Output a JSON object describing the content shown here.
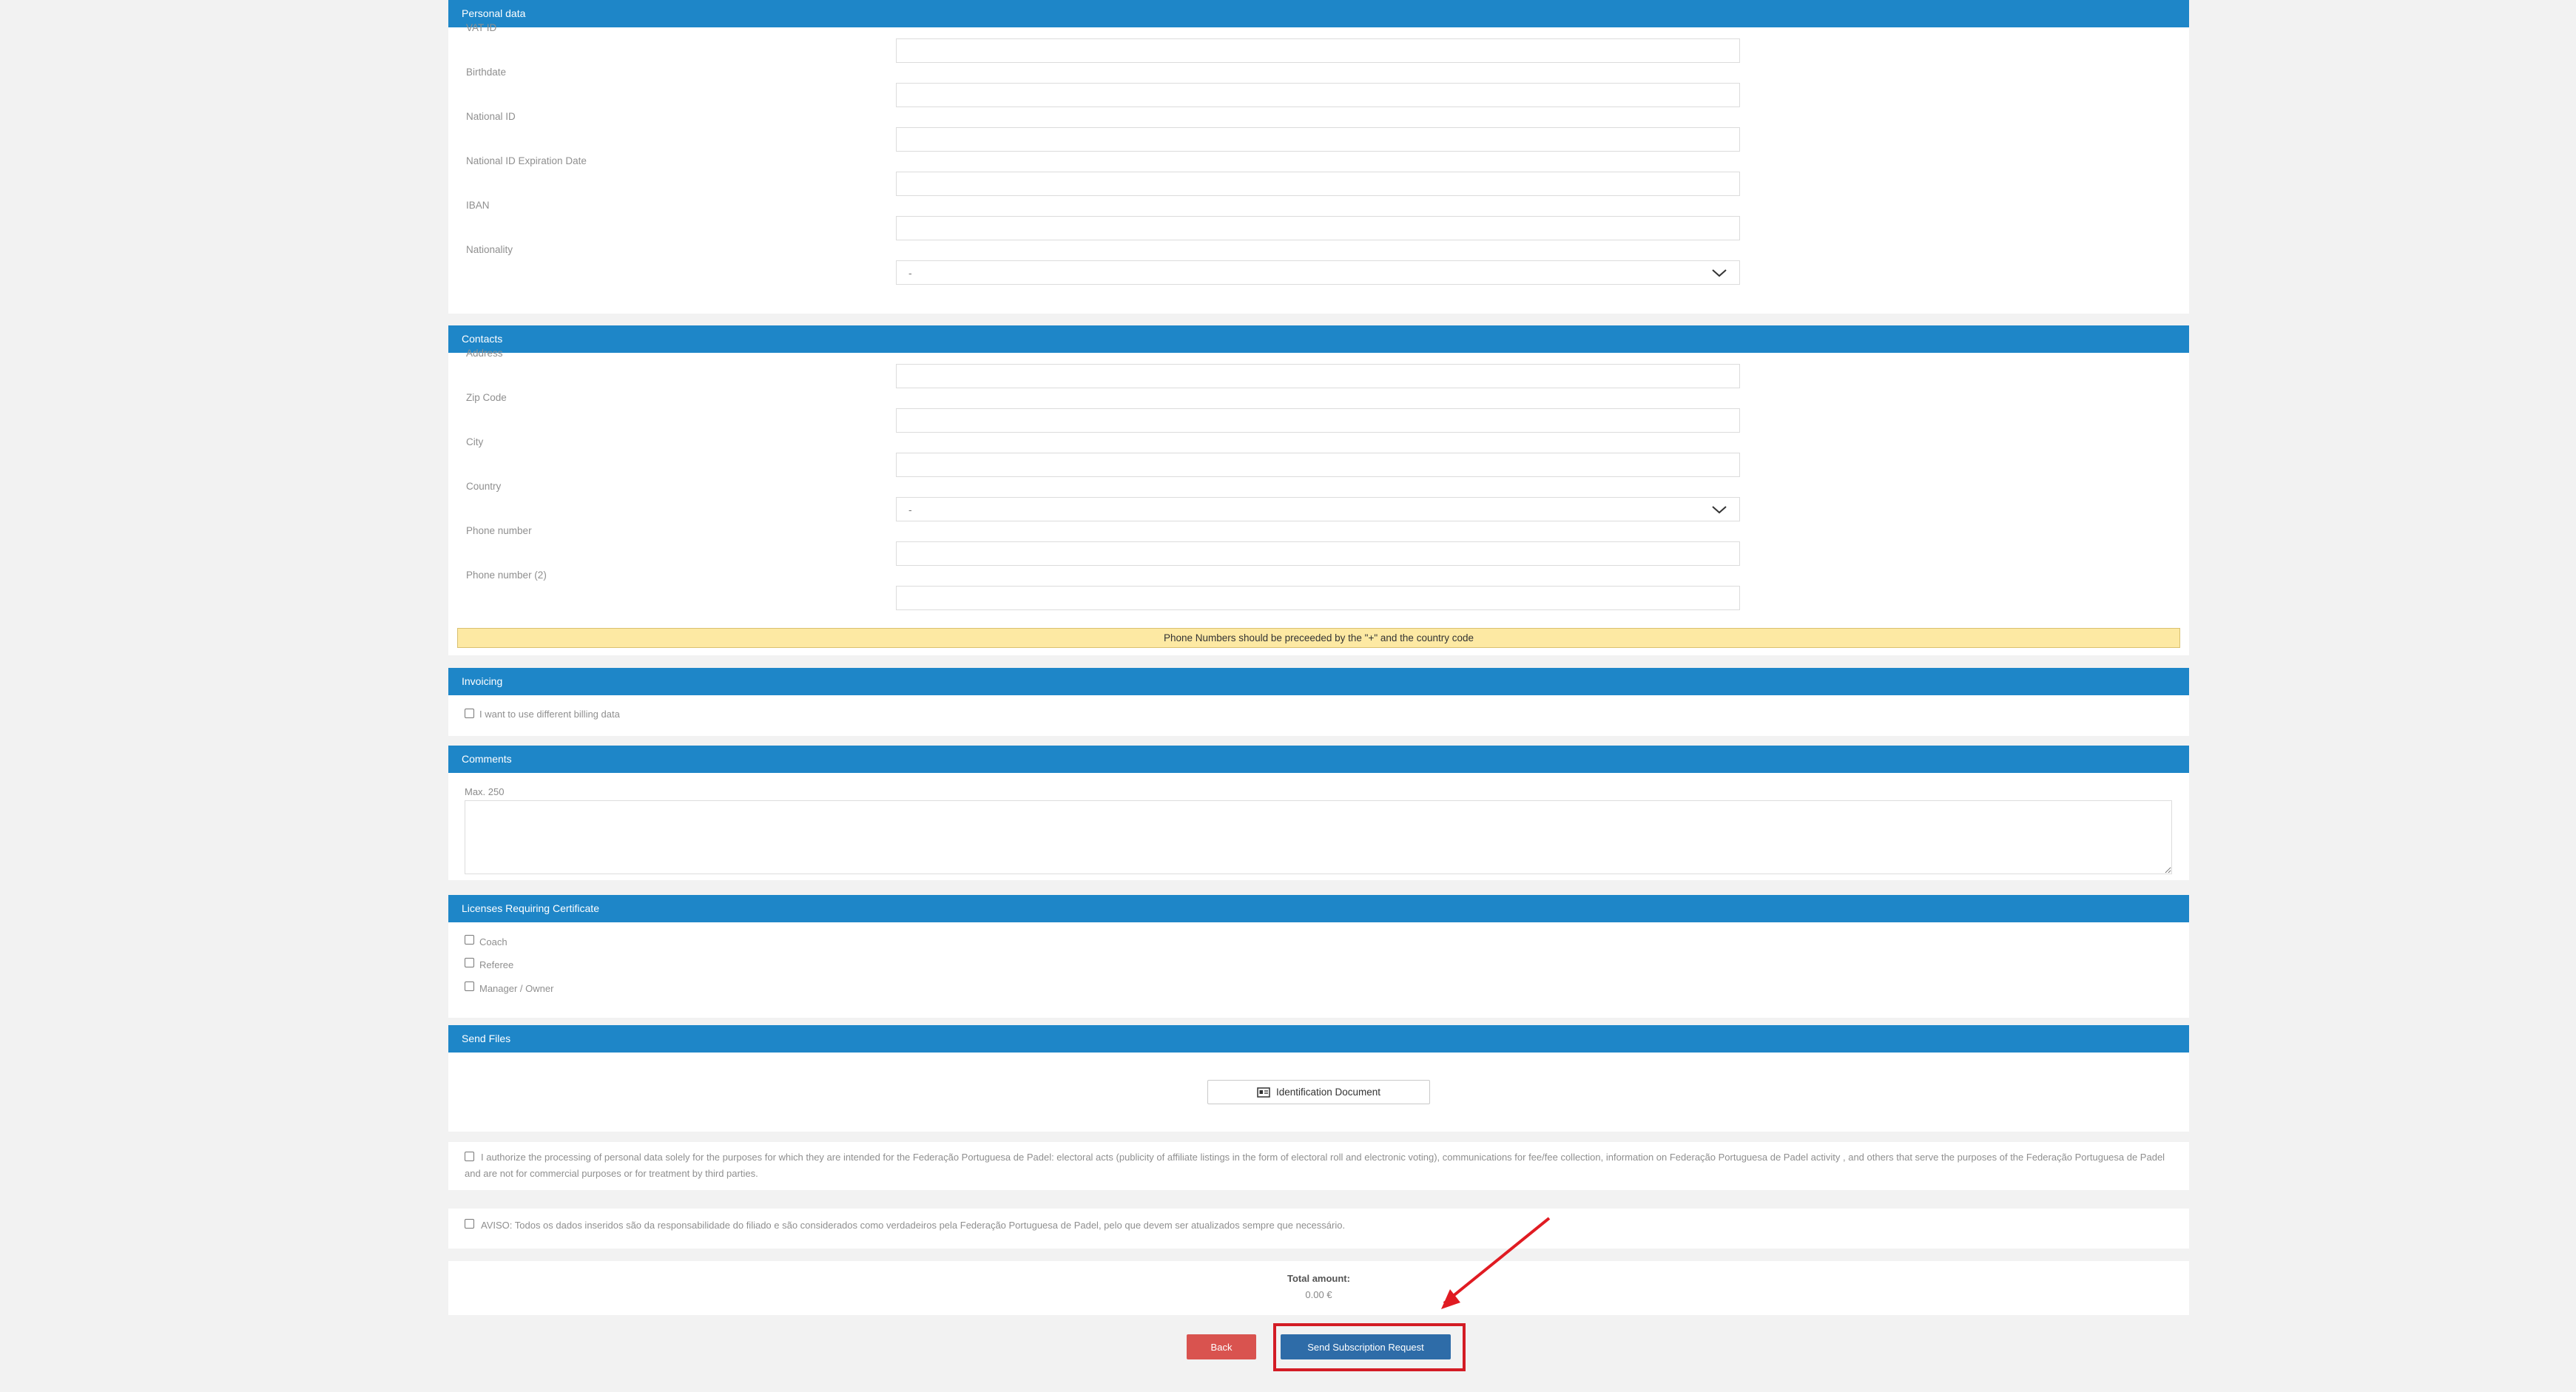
{
  "personal_data": {
    "header": "Personal data",
    "fields": [
      {
        "label": "VAT ID",
        "value": ""
      },
      {
        "label": "Birthdate",
        "value": ""
      },
      {
        "label": "National ID",
        "value": ""
      },
      {
        "label": "National ID Expiration Date",
        "value": ""
      },
      {
        "label": "IBAN",
        "value": ""
      }
    ],
    "nationality_label": "Nationality",
    "nationality_value": "-"
  },
  "contacts": {
    "header": "Contacts",
    "address_label": "Address",
    "zip_label": "Zip Code",
    "city_label": "City",
    "country_label": "Country",
    "country_value": "-",
    "phone_label": "Phone number",
    "phone2_label": "Phone number (2)",
    "notice": "Phone Numbers should be preceeded by the \"+\" and the country code"
  },
  "invoicing": {
    "header": "Invoicing",
    "checkbox_label": "I want to use different billing data"
  },
  "comments": {
    "header": "Comments",
    "max_label": "Max. 250"
  },
  "licenses": {
    "header": "Licenses Requiring Certificate",
    "options": [
      "Coach",
      "Referee",
      "Manager / Owner"
    ]
  },
  "send_files": {
    "header": "Send Files",
    "button_label": "Identification Document",
    "button_icon": "id-card-icon"
  },
  "consent": {
    "authorize_text": "I authorize the processing of personal data solely for the purposes for which they are intended for the Federação Portuguesa de Padel: electoral acts (publicity of affiliate listings in the form of electoral roll and electronic voting), communications for fee/fee collection, information on Federação Portuguesa de Padel activity , and others that serve the purposes of the Federação Portuguesa de Padel and are not for commercial purposes or for treatment by third parties.",
    "aviso_text": "AVISO: Todos os dados inseridos são da responsabilidade do filiado e são considerados como verdadeiros pela Federação Portuguesa de Padel, pelo que devem ser atualizados sempre que necessário."
  },
  "total": {
    "label": "Total amount:",
    "value": "0.00 €"
  },
  "actions": {
    "back_label": "Back",
    "send_label": "Send Subscription Request"
  },
  "colors": {
    "section_header": "#1e86c8",
    "back_button": "#d9534f",
    "send_button": "#2e6ca8",
    "highlight": "#d31c25",
    "notice_bg": "#fde9a3"
  }
}
